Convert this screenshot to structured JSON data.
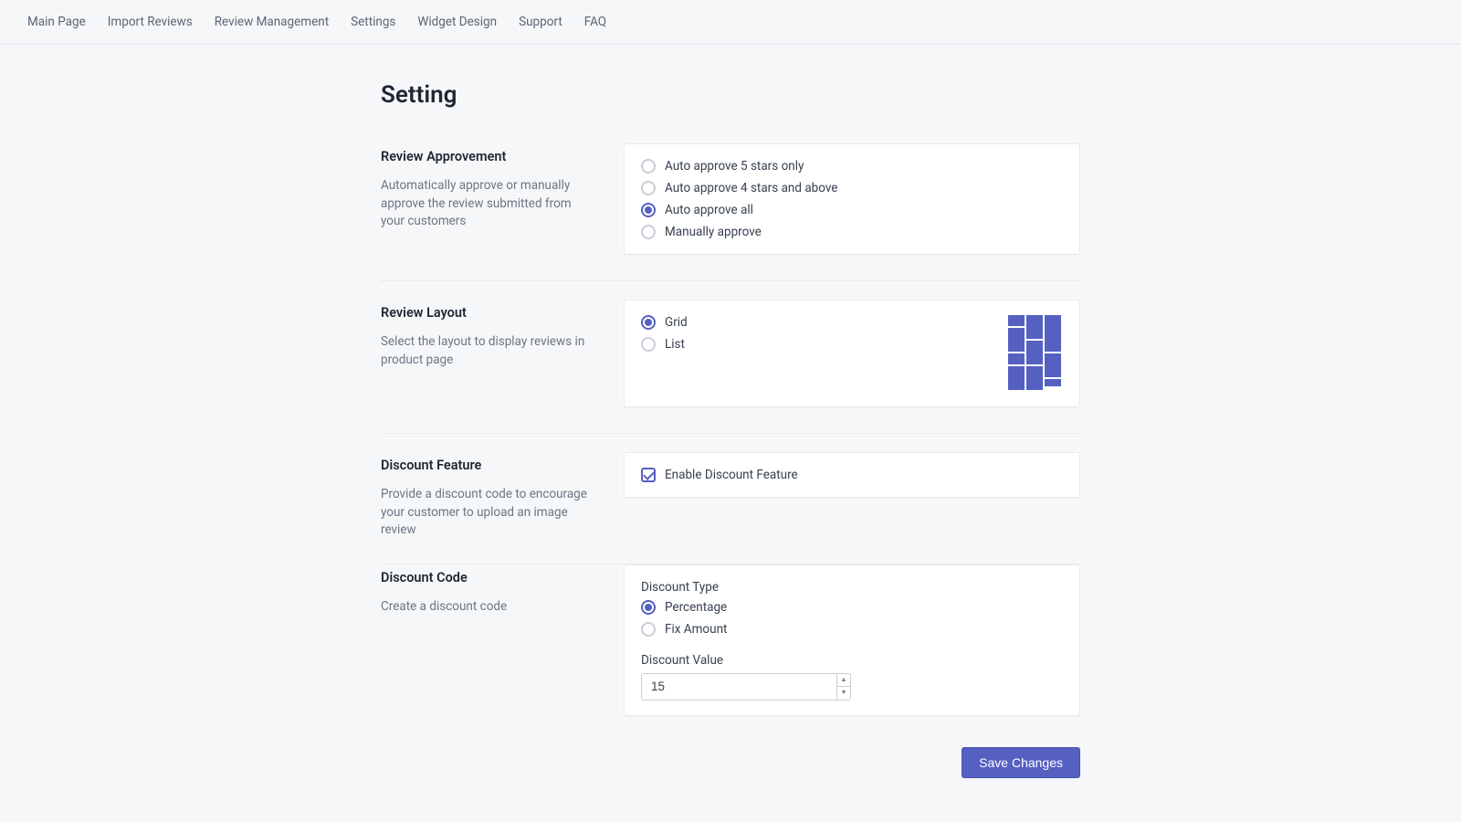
{
  "nav": {
    "items": [
      "Main Page",
      "Import Reviews",
      "Review Management",
      "Settings",
      "Widget Design",
      "Support",
      "FAQ"
    ]
  },
  "page": {
    "title": "Setting"
  },
  "sections": {
    "approvement": {
      "title": "Review Approvement",
      "desc": "Automatically approve or manually approve the review submitted from your customers",
      "options": [
        "Auto approve 5 stars only",
        "Auto approve 4 stars and above",
        "Auto approve all",
        "Manually approve"
      ],
      "selected": 2
    },
    "layout": {
      "title": "Review Layout",
      "desc": "Select the layout to display reviews in product page",
      "options": [
        "Grid",
        "List"
      ],
      "selected": 0
    },
    "discount_feature": {
      "title": "Discount Feature",
      "desc": "Provide a discount code to encourage your customer to upload an image review",
      "checkbox_label": "Enable Discount Feature",
      "enabled": true
    },
    "discount_code": {
      "title": "Discount Code",
      "desc": "Create a discount code",
      "type_label": "Discount Type",
      "type_options": [
        "Percentage",
        "Fix Amount"
      ],
      "type_selected": 0,
      "value_label": "Discount Value",
      "value": "15"
    }
  },
  "actions": {
    "save": "Save Changes"
  }
}
